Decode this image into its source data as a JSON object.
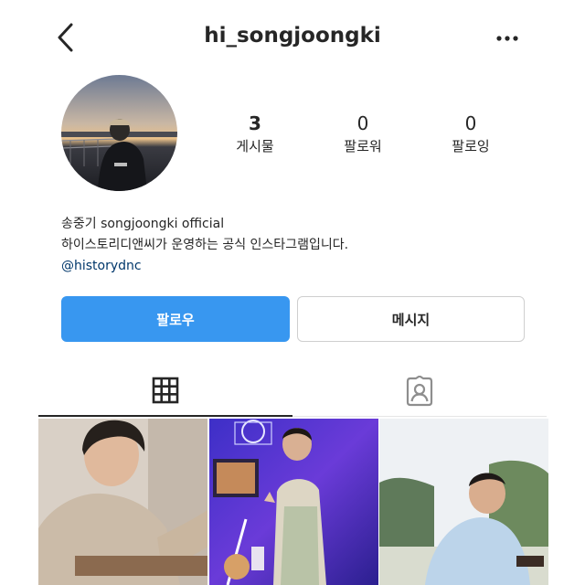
{
  "header": {
    "username": "hi_songjoongki",
    "back_icon": "chevron-left-icon",
    "more_icon": "more-horizontal-icon"
  },
  "profile": {
    "stats": [
      {
        "value": "3",
        "label": "게시물"
      },
      {
        "value": "0",
        "label": "팔로워"
      },
      {
        "value": "0",
        "label": "팔로잉"
      }
    ],
    "bio": {
      "name_line": "송중기 songjoongki official",
      "description": "하이스토리디앤씨가 운영하는 공식 인스타그램입니다.",
      "link": "@historydnc"
    }
  },
  "actions": {
    "follow_label": "팔로우",
    "message_label": "메시지"
  },
  "tabs": [
    {
      "name": "grid-icon",
      "active": true
    },
    {
      "name": "tagged-icon",
      "active": false
    }
  ],
  "posts": [
    {
      "index": 1
    },
    {
      "index": 2
    },
    {
      "index": 3
    }
  ],
  "colors": {
    "accent": "#3897f0",
    "text": "#262626",
    "link": "#00376b",
    "border": "#cfcfcf"
  }
}
